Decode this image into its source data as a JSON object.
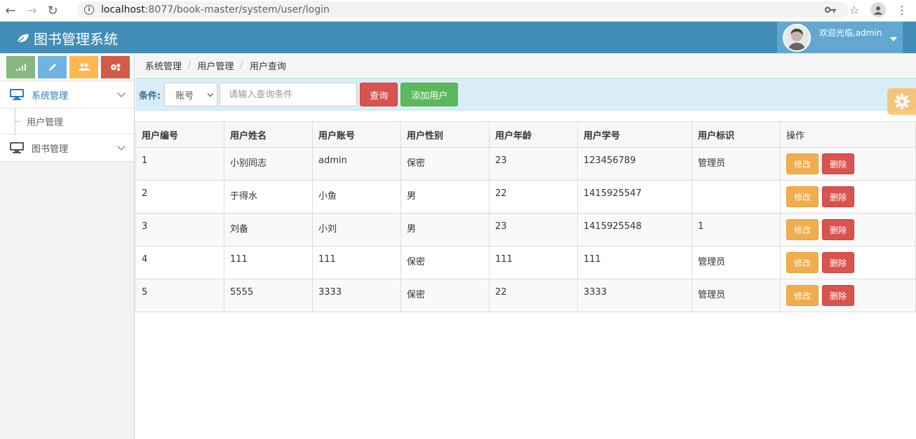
{
  "browser": {
    "url_host": "localhost",
    "url_path": ":8077/book-master/system/user/login"
  },
  "header": {
    "brand": "图书管理系统",
    "welcome": "欢迎光临,admin"
  },
  "sidebar": {
    "shortcut_colors": [
      "#87b87f",
      "#6fb3e0",
      "#ffb752",
      "#d15b47"
    ],
    "menu": [
      {
        "label": "系统管理",
        "icon": "monitor-icon",
        "expanded": true,
        "children": [
          {
            "label": "用户管理"
          }
        ]
      },
      {
        "label": "图书管理",
        "icon": "monitor-icon",
        "expanded": false
      }
    ]
  },
  "breadcrumb": [
    "系统管理",
    "用户管理",
    "用户查询"
  ],
  "filter": {
    "label": "条件:",
    "select_value": "账号",
    "input_placeholder": "请输入查询条件",
    "search_label": "查询",
    "add_label": "添加用户"
  },
  "table": {
    "headers": [
      "用户编号",
      "用户姓名",
      "用户账号",
      "用户性别",
      "用户年龄",
      "用户学号",
      "用户标识",
      "操作"
    ],
    "rows": [
      [
        "1",
        "小别同志",
        "admin",
        "保密",
        "23",
        "123456789",
        "管理员"
      ],
      [
        "2",
        "于得水",
        "小鱼",
        "男",
        "22",
        "1415925547",
        ""
      ],
      [
        "3",
        "刘备",
        "小刘",
        "男",
        "23",
        "1415925548",
        "1"
      ],
      [
        "4",
        "111",
        "111",
        "保密",
        "111",
        "111",
        "管理员"
      ],
      [
        "5",
        "5555",
        "3333",
        "保密",
        "22",
        "3333",
        "管理员"
      ]
    ],
    "edit_label": "修改",
    "delete_label": "删除"
  }
}
